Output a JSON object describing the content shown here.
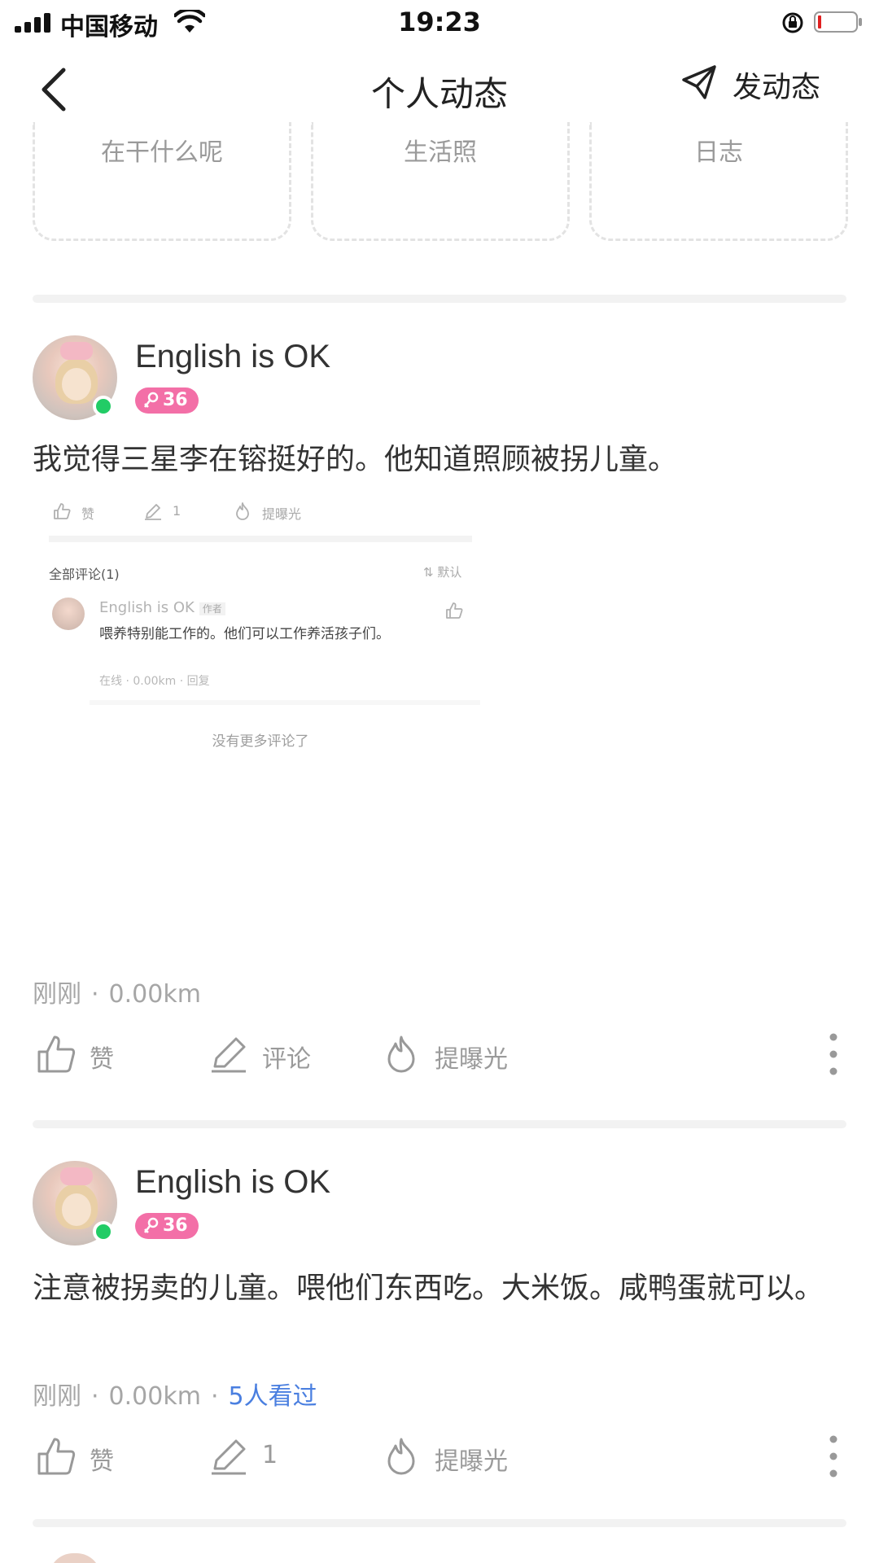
{
  "status_bar": {
    "carrier": "中国移动",
    "time": "19:23",
    "battery_color": "#e02020"
  },
  "nav": {
    "title": "个人动态",
    "post_label": "发动态"
  },
  "quick_cards": [
    "在干什么呢",
    "生活照",
    "日志"
  ],
  "posts": [
    {
      "username": "English is OK",
      "badge": "36",
      "text": "我觉得三星李在镕挺好的。他知道照顾被拐儿童。",
      "meta_time": "刚刚",
      "meta_distance": "0.00km",
      "actions": {
        "like": "赞",
        "comment": "评论",
        "expose": "提曝光"
      },
      "embed": {
        "like": "赞",
        "comment_count": "1",
        "expose": "提曝光",
        "all_comments": "全部评论(1)",
        "sort": "默认",
        "comment_user": "English is OK",
        "author_tag": "作者",
        "comment_text": "喂养特别能工作的。他们可以工作养活孩子们。",
        "comment_meta": "在线 · 0.00km · 回复",
        "no_more": "没有更多评论了"
      }
    },
    {
      "username": "English is OK",
      "badge": "36",
      "text": "注意被拐卖的儿童。喂他们东西吃。大米饭。咸鸭蛋就可以。",
      "meta_time": "刚刚",
      "meta_distance": "0.00km",
      "meta_views": "5人看过",
      "actions": {
        "like": "赞",
        "comment": "1",
        "expose": "提曝光"
      }
    }
  ],
  "colors": {
    "badge": "#f36fa7",
    "online": "#22cc66",
    "views_link": "#4a7fe0"
  }
}
